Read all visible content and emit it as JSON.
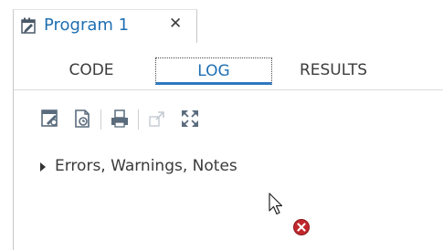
{
  "document_tab": {
    "title": "Program 1",
    "icon": "program-icon",
    "close_glyph": "✕",
    "accent": "#1f6fb2"
  },
  "subtabs": [
    {
      "label": "CODE",
      "selected": false
    },
    {
      "label": "LOG",
      "selected": true
    },
    {
      "label": "RESULTS",
      "selected": false
    }
  ],
  "toolbar": {
    "buttons": [
      "save-log-icon",
      "save-as-icon",
      "print-icon",
      "open-in-new-window-icon",
      "maximize-icon"
    ]
  },
  "log": {
    "section_label": "Errors, Warnings, Notes",
    "expanded": false
  },
  "status": {
    "error_icon": "error-icon",
    "error_color": "#c0282d"
  }
}
